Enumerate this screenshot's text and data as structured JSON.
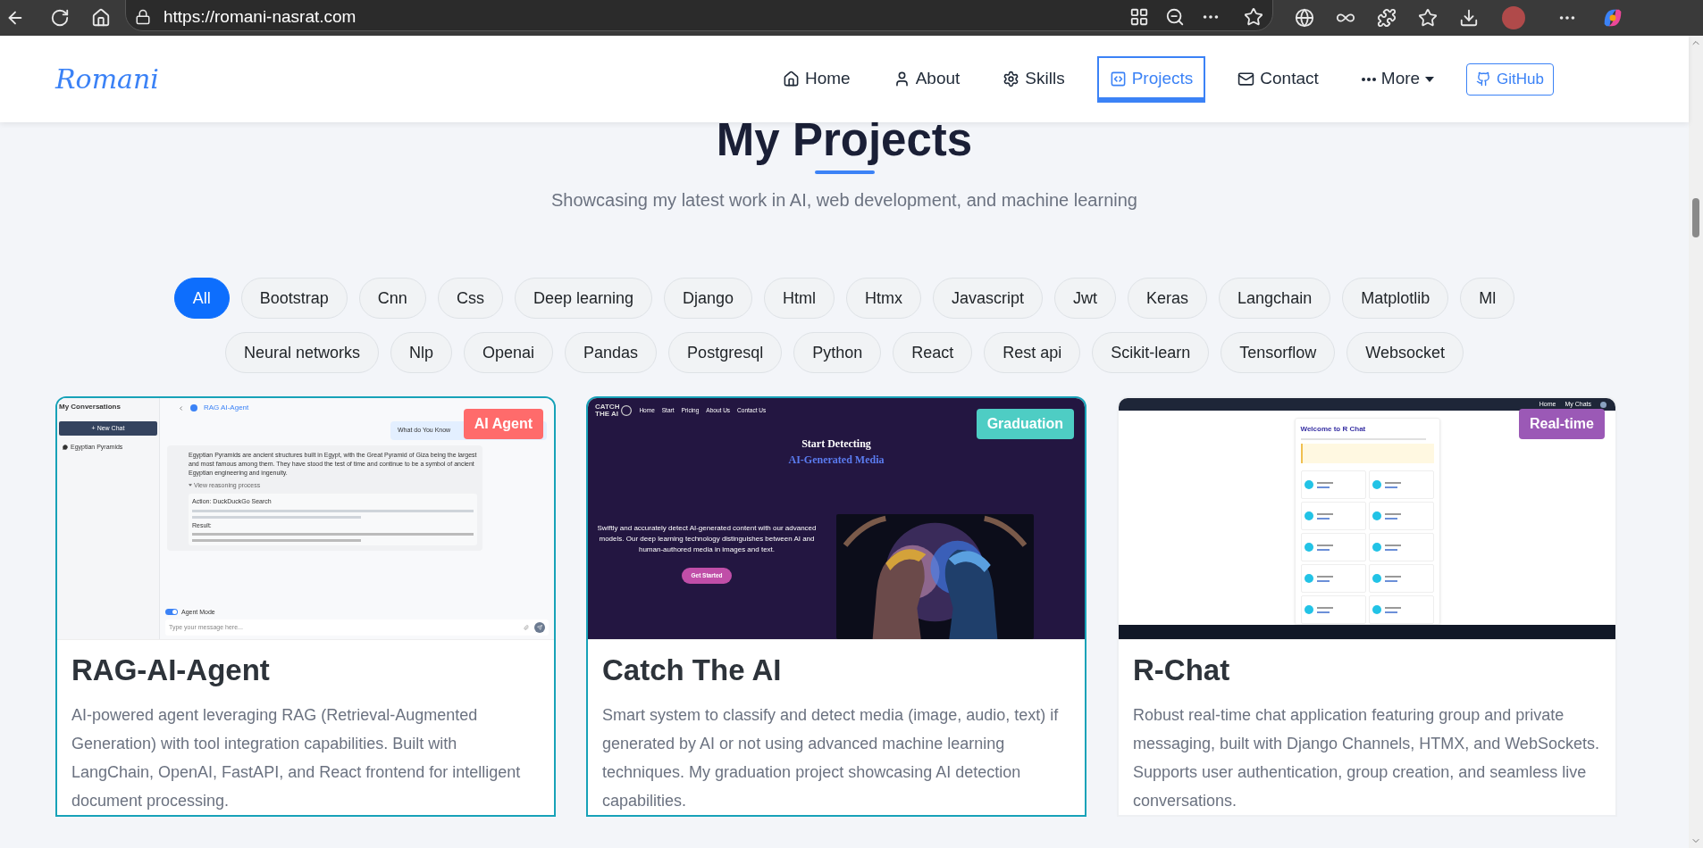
{
  "browser": {
    "url": "https://romani-nasrat.com"
  },
  "nav": {
    "logo": "Romani",
    "items": [
      {
        "label": "Home",
        "selected": false
      },
      {
        "label": "About",
        "selected": false
      },
      {
        "label": "Skills",
        "selected": false
      },
      {
        "label": "Projects",
        "selected": true
      },
      {
        "label": "Contact",
        "selected": false
      },
      {
        "label": "More",
        "selected": false
      }
    ],
    "github": "GitHub"
  },
  "header": {
    "title": "My Projects",
    "subtitle": "Showcasing my latest work in AI, web development, and machine learning"
  },
  "filters": [
    {
      "label": "All",
      "selected": true
    },
    {
      "label": "Bootstrap",
      "selected": false
    },
    {
      "label": "Cnn",
      "selected": false
    },
    {
      "label": "Css",
      "selected": false
    },
    {
      "label": "Deep learning",
      "selected": false
    },
    {
      "label": "Django",
      "selected": false
    },
    {
      "label": "Html",
      "selected": false
    },
    {
      "label": "Htmx",
      "selected": false
    },
    {
      "label": "Javascript",
      "selected": false
    },
    {
      "label": "Jwt",
      "selected": false
    },
    {
      "label": "Keras",
      "selected": false
    },
    {
      "label": "Langchain",
      "selected": false
    },
    {
      "label": "Matplotlib",
      "selected": false
    },
    {
      "label": "Ml",
      "selected": false
    },
    {
      "label": "Neural networks",
      "selected": false
    },
    {
      "label": "Nlp",
      "selected": false
    },
    {
      "label": "Openai",
      "selected": false
    },
    {
      "label": "Pandas",
      "selected": false
    },
    {
      "label": "Postgresql",
      "selected": false
    },
    {
      "label": "Python",
      "selected": false
    },
    {
      "label": "React",
      "selected": false
    },
    {
      "label": "Rest api",
      "selected": false
    },
    {
      "label": "Scikit-learn",
      "selected": false
    },
    {
      "label": "Tensorflow",
      "selected": false
    },
    {
      "label": "Websocket",
      "selected": false
    }
  ],
  "projects": [
    {
      "title": "RAG-AI-Agent",
      "description": "AI-powered agent leveraging RAG (Retrieval-Augmented Generation) with tool integration capabilities. Built with LangChain, OpenAI, FastAPI, and React frontend for intelligent document processing.",
      "badge": {
        "label": "AI Agent",
        "color": "#ff6b6b"
      },
      "outlined": true,
      "preview": {
        "kind": "chat",
        "sidebar_title": "My Conversations",
        "new_chat": "+ New Chat",
        "conversation": "Egyptian Pyramids",
        "app_title": "RAG AI-Agent",
        "user_message": "What do You Know",
        "reply": "Egyptian Pyramids are ancient structures built in Egypt, with the Great Pyramid of Giza being the largest and most famous among them. They have stood the test of time and continue to be a symbol of ancient Egyptian engineering and ingenuity.",
        "reasoning": "View reasoning process",
        "action": "Action: DuckDuckGo Search",
        "result_label": "Result:",
        "toggle_label": "Agent Mode",
        "toggle_on": true,
        "placeholder": "Type your message here..."
      }
    },
    {
      "title": "Catch The AI",
      "description": "Smart system to classify and detect media (image, audio, text) if generated by AI or not using advanced machine learning techniques. My graduation project showcasing AI detection capabilities.",
      "badge": {
        "label": "Graduation",
        "color": "#4ecdc4"
      },
      "outlined": true,
      "preview": {
        "kind": "landing",
        "brand": [
          "CATCH",
          "THE AI"
        ],
        "links": [
          "Home",
          "Start",
          "Pricing",
          "About Us",
          "Contact Us"
        ],
        "heading": "Start Detecting",
        "heading_accent": "AI-Generated Media",
        "body": "Swiftly and accurately detect AI-generated content with our advanced models. Our deep learning technology distinguishes between AI and human-authored media in images and text.",
        "button": "Get Started"
      }
    },
    {
      "title": "R-Chat",
      "description": "Robust real-time chat application featuring group and private messaging, built with Django Channels, HTMX, and WebSockets. Supports user authentication, group creation, and seamless live conversations.",
      "badge": {
        "label": "Real-time",
        "color": "#9b59b6"
      },
      "outlined": false,
      "preview": {
        "kind": "dashboard",
        "links": [
          "Home",
          "My Chats"
        ],
        "welcome": "Welcome to R Chat"
      }
    }
  ]
}
